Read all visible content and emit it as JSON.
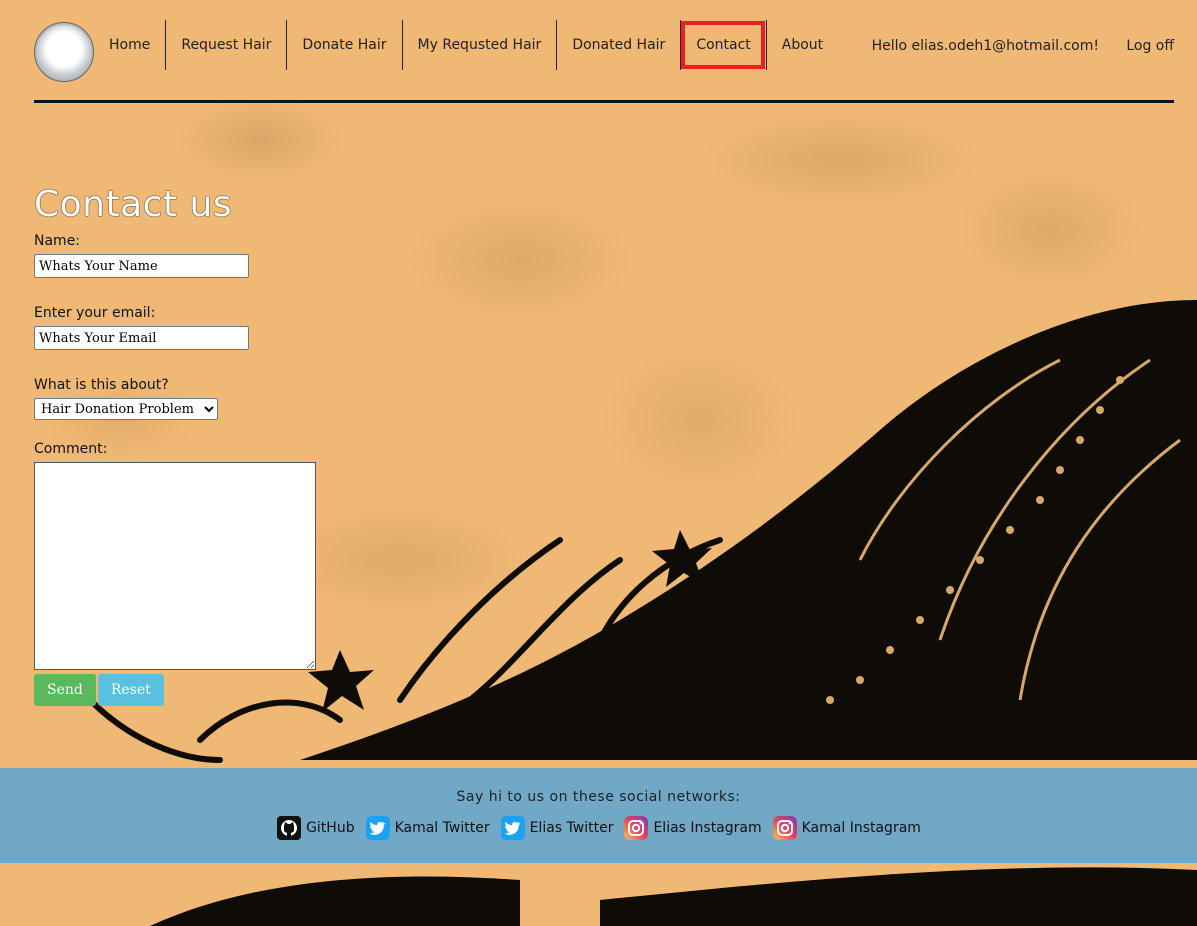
{
  "nav": {
    "items": [
      {
        "label": "Home"
      },
      {
        "label": "Request Hair"
      },
      {
        "label": "Donate Hair"
      },
      {
        "label": "My Requsted Hair"
      },
      {
        "label": "Donated Hair"
      },
      {
        "label": "Contact",
        "active": true
      },
      {
        "label": "About"
      }
    ],
    "greeting": "Hello elias.odeh1@hotmail.com!",
    "logoff": "Log off"
  },
  "form": {
    "title": "Contact us",
    "name_label": "Name:",
    "name_value": "Whats Your Name",
    "email_label": "Enter your email:",
    "email_value": "Whats Your Email",
    "topic_label": "What is this about?",
    "topic_selected": "Hair Donation Problem",
    "comment_label": "Comment:",
    "comment_value": "",
    "send_label": "Send",
    "reset_label": "Reset"
  },
  "footer": {
    "title": "Say hi to us on these social networks:",
    "links": [
      {
        "label": "GitHub",
        "icon": "github-icon"
      },
      {
        "label": "Kamal Twitter",
        "icon": "twitter-icon"
      },
      {
        "label": "Elias Twitter",
        "icon": "twitter-icon"
      },
      {
        "label": "Elias Instagram",
        "icon": "instagram-icon"
      },
      {
        "label": "Kamal Instagram",
        "icon": "instagram-icon"
      }
    ]
  },
  "colors": {
    "background": "#efb874",
    "footer": "#71a8c6",
    "send": "#5cb85c",
    "reset": "#5bc0de",
    "active_outline": "#e8231f"
  }
}
